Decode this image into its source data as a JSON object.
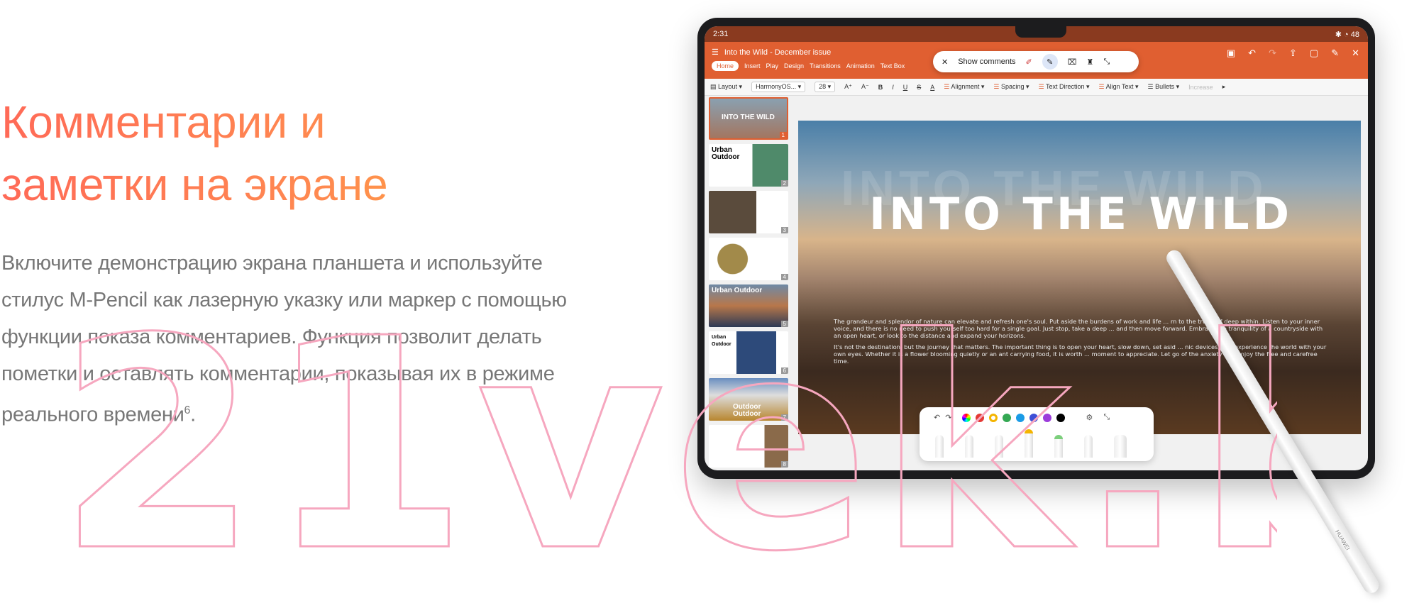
{
  "heading": {
    "line1": "Комментарии и",
    "line2": "заметки на экране"
  },
  "body": {
    "text": "Включите демонстрацию экрана планшета и используйте стилус M-Pencil как лазерную указку или маркер с помощью функции показа комментариев. Функция позволит делать пометки и оставлять комментарии, показывая их в режиме реального времени",
    "footnote": "6",
    "end": "."
  },
  "tablet": {
    "status": {
      "time": "2:31",
      "battery": "48"
    },
    "app": {
      "title": "Into the Wild - December issue",
      "tabs": [
        "Home",
        "Insert",
        "Play",
        "Design",
        "Transitions",
        "Animation",
        "Text Box"
      ],
      "active_tab": "Home"
    },
    "comment_bar": {
      "label": "Show comments",
      "icons": [
        "close-icon",
        "laser-pointer-icon",
        "pen-icon",
        "eraser-icon",
        "clear-icon",
        "collapse-icon"
      ]
    },
    "toolbar": {
      "layout": "Layout",
      "font": "HarmonyOS...",
      "size": "28",
      "alignment": "Alignment",
      "spacing": "Spacing",
      "text_direction": "Text Direction",
      "align_text": "Align Text",
      "bullets": "Bullets",
      "increase": "Increase"
    },
    "thumbnails": [
      {
        "num": "1",
        "title": "INTO THE WILD"
      },
      {
        "num": "2",
        "title": "Urban Outdoor"
      },
      {
        "num": "3",
        "title": ""
      },
      {
        "num": "4",
        "title": ""
      },
      {
        "num": "5",
        "title": "Urban Outdoor"
      },
      {
        "num": "6",
        "title": "Urban Outdoor"
      },
      {
        "num": "7",
        "title": "Outdoor Outdoor"
      },
      {
        "num": "8",
        "title": ""
      }
    ],
    "slide": {
      "title": "INTO THE WILD",
      "p1": "The grandeur and splendor of nature can elevate and refresh one's soul. Put aside the burdens of work and life ... rn to the true self deep within. Listen to your inner voice, and there is no need to push yourself too hard for a single goal. Just stop, take a deep ... and then move forward. Embrace the tranquility of a countryside with an open heart, or look to the distance and expand your horizons.",
      "p2": "It's not the destination, but the journey that matters. The important thing is to open your heart, slow down, set asid ... nic devices, and experience the world with your own eyes. Whether it is a flower blooming quietly or an ant carrying food, it is worth ... moment to appreciate. Let go of the anxiety and enjoy the free and carefree time."
    },
    "pen_colors": [
      "#e53935",
      "#f4b400",
      "#34a853",
      "#1a9be6",
      "#3d4fd6",
      "#9c3cdb",
      "#000000"
    ],
    "selected_color": "#f4b400"
  },
  "stylus": {
    "brand": "HUAWEI"
  },
  "watermark": "21vek.by"
}
